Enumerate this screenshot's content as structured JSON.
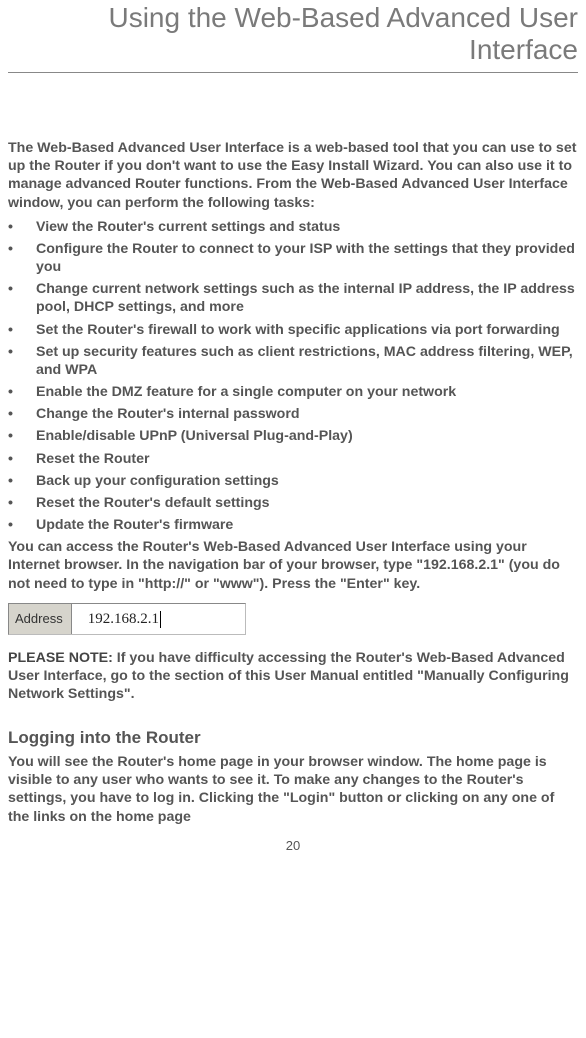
{
  "title": "Using the Web-Based Advanced User Interface",
  "intro": "The Web-Based Advanced User Interface is a web-based tool that you can use to set up the Router if you don't want to use the Easy Install Wizard. You can also use it to manage advanced Router functions. From the Web-Based Advanced User Interface window, you can perform the following tasks:",
  "bullets": [
    "View the Router's current settings and status",
    "Configure the Router to connect to your ISP with the settings that they provided you",
    "Change current network settings such as the internal IP address, the IP address pool, DHCP settings, and more",
    "Set the Router's firewall to work with specific applications via port forwarding",
    "Set up security features such as client restrictions, MAC address filtering, WEP, and WPA",
    "Enable the DMZ feature for a single computer on your network",
    "Change the Router's internal password",
    "Enable/disable UPnP (Universal Plug-and-Play)",
    "Reset the Router",
    "Back up your configuration settings",
    "Reset the Router's default settings",
    "Update the Router's firmware"
  ],
  "access": "You can access the Router's Web-Based Advanced User Interface using your Internet browser. In the navigation bar of your browser, type \"192.168.2.1\" (you do not need to type in \"http://\" or \"www\"). Press the \"Enter\" key.",
  "addressLabel": "Address",
  "addressValue": "192.168.2.1",
  "noteBold": "PLEASE NOTE:",
  "noteText": " If you have difficulty accessing the Router's Web-Based Advanced User Interface, go to the section of this User Manual entitled \"Manually Configuring Network Settings\".",
  "subhead": "Logging into the Router",
  "loginText": "You will see the Router's home page in your browser window. The home page is visible to any user who wants to see it. To make any changes to the Router's settings, you have to log in. Clicking the \"Login\" button or clicking on any one of the links on the home page",
  "pageNumber": "20"
}
